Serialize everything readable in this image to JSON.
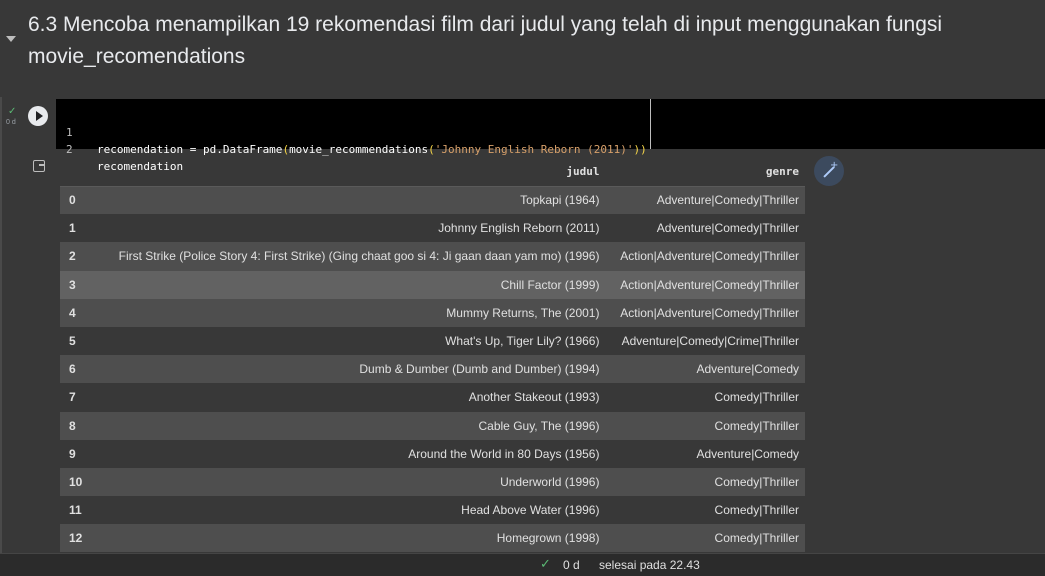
{
  "text_cell": {
    "heading": "6.3 Mencoba menampilkan 19 rekomendasi film dari judul yang telah di input menggunakan fungsi movie_recomendations"
  },
  "code_cell": {
    "exec_count": "0 d",
    "lines": [
      {
        "num": "1",
        "pre": "recomendation = pd.DataFrame",
        "open_paren": "(",
        "fn": "movie_recommendations",
        "open_paren2": "(",
        "str": "'Johnny English Reborn (2011)'",
        "close": "))"
      },
      {
        "num": "2",
        "code": "recomendation"
      }
    ]
  },
  "output": {
    "columns": [
      "",
      "judul",
      "genre"
    ],
    "rows": [
      {
        "idx": "0",
        "judul": "Topkapi (1964)",
        "genre": "Adventure|Comedy|Thriller"
      },
      {
        "idx": "1",
        "judul": "Johnny English Reborn (2011)",
        "genre": "Adventure|Comedy|Thriller"
      },
      {
        "idx": "2",
        "judul": "First Strike (Police Story 4: First Strike) (Ging chaat goo si 4: Ji gaan daan yam mo) (1996)",
        "genre": "Action|Adventure|Comedy|Thriller"
      },
      {
        "idx": "3",
        "judul": "Chill Factor (1999)",
        "genre": "Action|Adventure|Comedy|Thriller"
      },
      {
        "idx": "4",
        "judul": "Mummy Returns, The (2001)",
        "genre": "Action|Adventure|Comedy|Thriller"
      },
      {
        "idx": "5",
        "judul": "What's Up, Tiger Lily? (1966)",
        "genre": "Adventure|Comedy|Crime|Thriller"
      },
      {
        "idx": "6",
        "judul": "Dumb & Dumber (Dumb and Dumber) (1994)",
        "genre": "Adventure|Comedy"
      },
      {
        "idx": "7",
        "judul": "Another Stakeout (1993)",
        "genre": "Comedy|Thriller"
      },
      {
        "idx": "8",
        "judul": "Cable Guy, The (1996)",
        "genre": "Comedy|Thriller"
      },
      {
        "idx": "9",
        "judul": "Around the World in 80 Days (1956)",
        "genre": "Adventure|Comedy"
      },
      {
        "idx": "10",
        "judul": "Underworld (1996)",
        "genre": "Comedy|Thriller"
      },
      {
        "idx": "11",
        "judul": "Head Above Water (1996)",
        "genre": "Comedy|Thriller"
      },
      {
        "idx": "12",
        "judul": "Homegrown (1998)",
        "genre": "Comedy|Thriller"
      }
    ],
    "hover_row": 3
  },
  "status_bar": {
    "time": "0 d",
    "text": "selesai pada 22.43"
  },
  "icons": {
    "collapse": "chevron-down-icon",
    "run": "play-icon",
    "output": "output-icon",
    "magic": "magic-wand-icon",
    "check": "check-icon"
  }
}
